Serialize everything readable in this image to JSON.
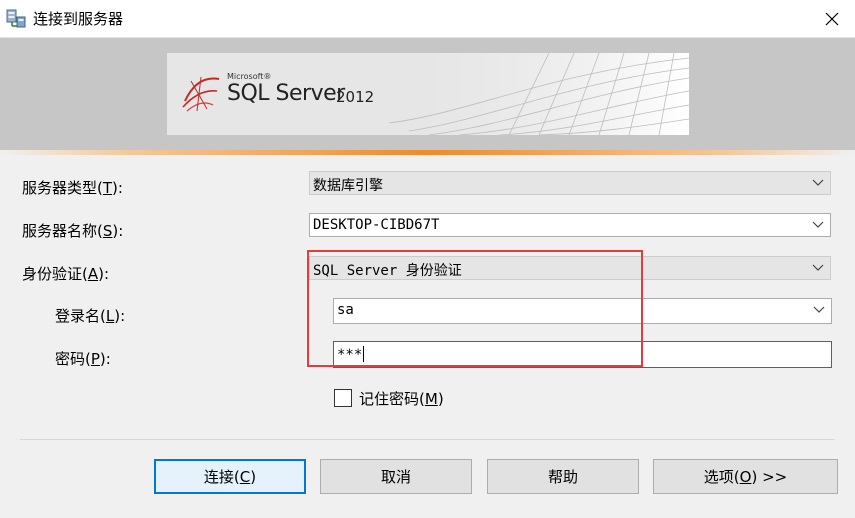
{
  "window": {
    "title": "连接到服务器",
    "icon": "server-connect-icon",
    "close_icon": "close-icon"
  },
  "banner": {
    "brand_small": "Microsoft®",
    "product": "SQL Server",
    "version": "2012"
  },
  "form": {
    "server_type": {
      "label": "服务器类型",
      "mnemonic": "T",
      "value": "数据库引擎"
    },
    "server_name": {
      "label": "服务器名称",
      "mnemonic": "S",
      "value": "DESKTOP-CIBD67T"
    },
    "auth": {
      "label": "身份验证",
      "mnemonic": "A",
      "value": "SQL Server 身份验证"
    },
    "login": {
      "label": "登录名",
      "mnemonic": "L",
      "value": "sa"
    },
    "password": {
      "label": "密码",
      "mnemonic": "P",
      "value": "***"
    },
    "remember": {
      "label": "记住密码",
      "mnemonic": "M",
      "checked": false
    }
  },
  "buttons": {
    "connect": {
      "label": "连接",
      "mnemonic": "C"
    },
    "cancel": {
      "label": "取消"
    },
    "help": {
      "label": "帮助"
    },
    "options": {
      "label": "选项",
      "mnemonic": "O",
      "suffix": ">>"
    }
  },
  "colors": {
    "highlight_box": "#e63b3b",
    "accent": "#0078d7",
    "stripe": "#f08a2a"
  }
}
